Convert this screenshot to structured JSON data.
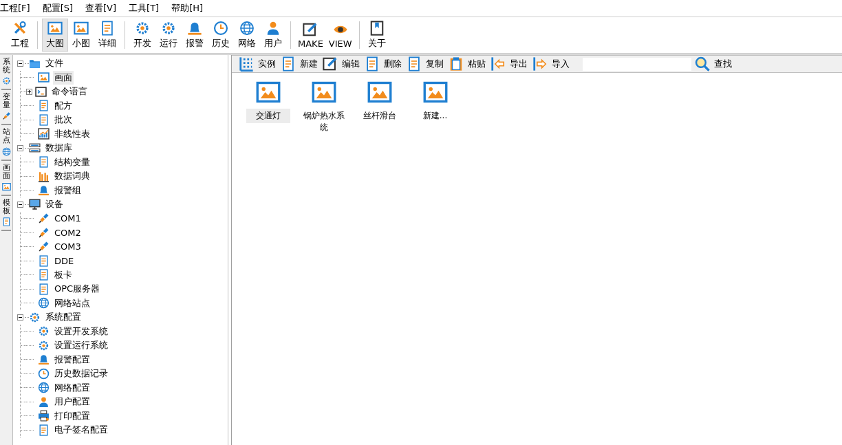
{
  "menu": [
    {
      "label": "工程[F]"
    },
    {
      "label": "配置[S]"
    },
    {
      "label": "查看[V]"
    },
    {
      "label": "工具[T]"
    },
    {
      "label": "帮助[H]"
    }
  ],
  "toolbar": [
    [
      {
        "label": "工程",
        "selected": false
      }
    ],
    [
      {
        "label": "大图",
        "selected": true
      },
      {
        "label": "小图",
        "selected": false
      },
      {
        "label": "详细",
        "selected": false
      }
    ],
    [
      {
        "label": "开发",
        "selected": false
      },
      {
        "label": "运行",
        "selected": false
      },
      {
        "label": "报警",
        "selected": false
      },
      {
        "label": "历史",
        "selected": false
      },
      {
        "label": "网络",
        "selected": false
      },
      {
        "label": "用户",
        "selected": false
      }
    ],
    [
      {
        "label": "MAKE",
        "selected": false
      },
      {
        "label": "VIEW",
        "selected": false
      }
    ],
    [
      {
        "label": "关于",
        "selected": false
      }
    ]
  ],
  "side_tabs": [
    {
      "label": "系统"
    },
    {
      "label": "变量"
    },
    {
      "label": "站点"
    },
    {
      "label": "画面"
    },
    {
      "label": "模板"
    }
  ],
  "tree": [
    {
      "label": "文件",
      "expanded": true,
      "selected": false,
      "children": [
        {
          "label": "画面",
          "selected": true
        },
        {
          "label": "命令语言",
          "expanded": false,
          "selected": false
        },
        {
          "label": "配方",
          "selected": false
        },
        {
          "label": "批次",
          "selected": false
        },
        {
          "label": "非线性表",
          "selected": false
        }
      ]
    },
    {
      "label": "数据库",
      "expanded": true,
      "selected": false,
      "children": [
        {
          "label": "结构变量",
          "selected": false
        },
        {
          "label": "数据词典",
          "selected": false
        },
        {
          "label": "报警组",
          "selected": false
        }
      ]
    },
    {
      "label": "设备",
      "expanded": true,
      "selected": false,
      "children": [
        {
          "label": "COM1",
          "selected": false
        },
        {
          "label": "COM2",
          "selected": false
        },
        {
          "label": "COM3",
          "selected": false
        },
        {
          "label": "DDE",
          "selected": false
        },
        {
          "label": "板卡",
          "selected": false
        },
        {
          "label": "OPC服务器",
          "selected": false
        },
        {
          "label": "网络站点",
          "selected": false
        }
      ]
    },
    {
      "label": "系统配置",
      "expanded": true,
      "selected": false,
      "children": [
        {
          "label": "设置开发系统",
          "selected": false
        },
        {
          "label": "设置运行系统",
          "selected": false
        },
        {
          "label": "报警配置",
          "selected": false
        },
        {
          "label": "历史数据记录",
          "selected": false
        },
        {
          "label": "网络配置",
          "selected": false
        },
        {
          "label": "用户配置",
          "selected": false
        },
        {
          "label": "打印配置",
          "selected": false
        },
        {
          "label": "电子签名配置",
          "selected": false
        }
      ]
    }
  ],
  "actions": [
    {
      "label": "实例"
    },
    {
      "label": "新建"
    },
    {
      "label": "编辑"
    },
    {
      "label": "删除"
    },
    {
      "label": "复制"
    },
    {
      "label": "粘贴"
    },
    {
      "label": "导出"
    },
    {
      "label": "导入"
    }
  ],
  "search_button": "查找",
  "items": [
    {
      "label": "交通灯",
      "selected": true
    },
    {
      "label": "锅炉热水系统",
      "selected": false
    },
    {
      "label": "丝杆滑台",
      "selected": false
    },
    {
      "label": "新建...",
      "selected": false
    }
  ]
}
